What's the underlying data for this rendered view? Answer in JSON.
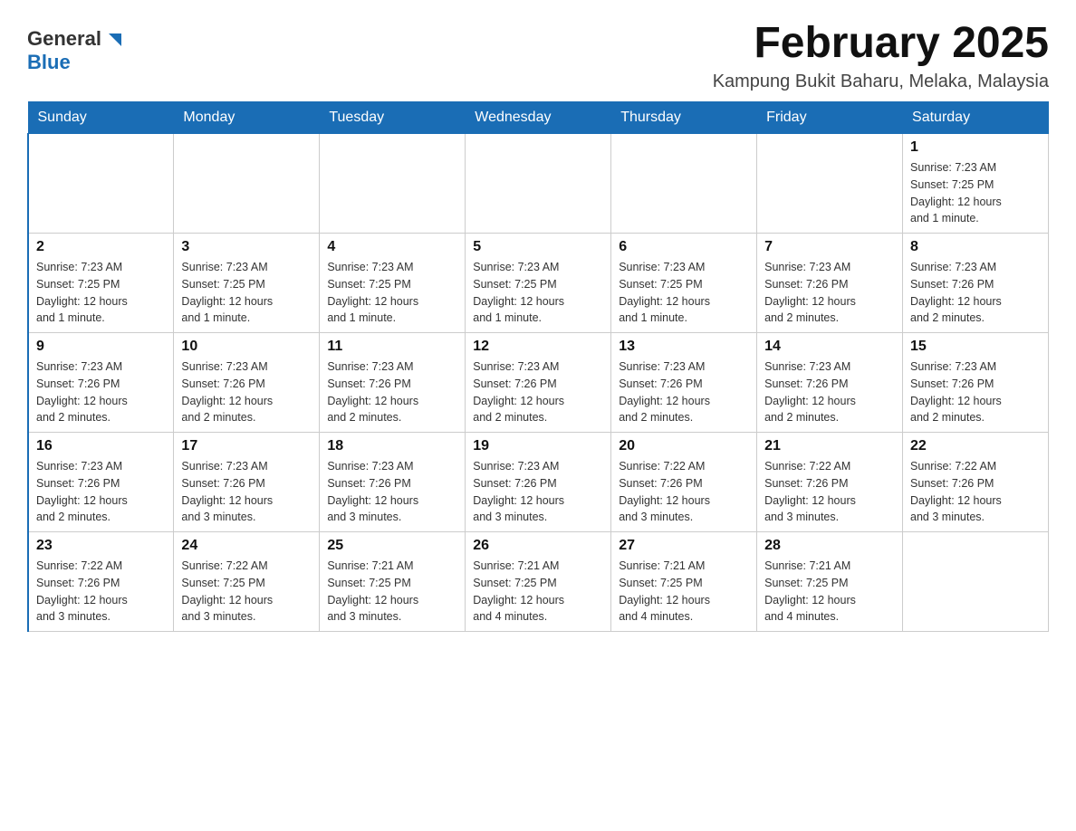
{
  "header": {
    "logo_general": "General",
    "logo_blue": "Blue",
    "month_title": "February 2025",
    "location": "Kampung Bukit Baharu, Melaka, Malaysia"
  },
  "days_of_week": [
    "Sunday",
    "Monday",
    "Tuesday",
    "Wednesday",
    "Thursday",
    "Friday",
    "Saturday"
  ],
  "weeks": [
    [
      {
        "day": "",
        "info": ""
      },
      {
        "day": "",
        "info": ""
      },
      {
        "day": "",
        "info": ""
      },
      {
        "day": "",
        "info": ""
      },
      {
        "day": "",
        "info": ""
      },
      {
        "day": "",
        "info": ""
      },
      {
        "day": "1",
        "info": "Sunrise: 7:23 AM\nSunset: 7:25 PM\nDaylight: 12 hours\nand 1 minute."
      }
    ],
    [
      {
        "day": "2",
        "info": "Sunrise: 7:23 AM\nSunset: 7:25 PM\nDaylight: 12 hours\nand 1 minute."
      },
      {
        "day": "3",
        "info": "Sunrise: 7:23 AM\nSunset: 7:25 PM\nDaylight: 12 hours\nand 1 minute."
      },
      {
        "day": "4",
        "info": "Sunrise: 7:23 AM\nSunset: 7:25 PM\nDaylight: 12 hours\nand 1 minute."
      },
      {
        "day": "5",
        "info": "Sunrise: 7:23 AM\nSunset: 7:25 PM\nDaylight: 12 hours\nand 1 minute."
      },
      {
        "day": "6",
        "info": "Sunrise: 7:23 AM\nSunset: 7:25 PM\nDaylight: 12 hours\nand 1 minute."
      },
      {
        "day": "7",
        "info": "Sunrise: 7:23 AM\nSunset: 7:26 PM\nDaylight: 12 hours\nand 2 minutes."
      },
      {
        "day": "8",
        "info": "Sunrise: 7:23 AM\nSunset: 7:26 PM\nDaylight: 12 hours\nand 2 minutes."
      }
    ],
    [
      {
        "day": "9",
        "info": "Sunrise: 7:23 AM\nSunset: 7:26 PM\nDaylight: 12 hours\nand 2 minutes."
      },
      {
        "day": "10",
        "info": "Sunrise: 7:23 AM\nSunset: 7:26 PM\nDaylight: 12 hours\nand 2 minutes."
      },
      {
        "day": "11",
        "info": "Sunrise: 7:23 AM\nSunset: 7:26 PM\nDaylight: 12 hours\nand 2 minutes."
      },
      {
        "day": "12",
        "info": "Sunrise: 7:23 AM\nSunset: 7:26 PM\nDaylight: 12 hours\nand 2 minutes."
      },
      {
        "day": "13",
        "info": "Sunrise: 7:23 AM\nSunset: 7:26 PM\nDaylight: 12 hours\nand 2 minutes."
      },
      {
        "day": "14",
        "info": "Sunrise: 7:23 AM\nSunset: 7:26 PM\nDaylight: 12 hours\nand 2 minutes."
      },
      {
        "day": "15",
        "info": "Sunrise: 7:23 AM\nSunset: 7:26 PM\nDaylight: 12 hours\nand 2 minutes."
      }
    ],
    [
      {
        "day": "16",
        "info": "Sunrise: 7:23 AM\nSunset: 7:26 PM\nDaylight: 12 hours\nand 2 minutes."
      },
      {
        "day": "17",
        "info": "Sunrise: 7:23 AM\nSunset: 7:26 PM\nDaylight: 12 hours\nand 3 minutes."
      },
      {
        "day": "18",
        "info": "Sunrise: 7:23 AM\nSunset: 7:26 PM\nDaylight: 12 hours\nand 3 minutes."
      },
      {
        "day": "19",
        "info": "Sunrise: 7:23 AM\nSunset: 7:26 PM\nDaylight: 12 hours\nand 3 minutes."
      },
      {
        "day": "20",
        "info": "Sunrise: 7:22 AM\nSunset: 7:26 PM\nDaylight: 12 hours\nand 3 minutes."
      },
      {
        "day": "21",
        "info": "Sunrise: 7:22 AM\nSunset: 7:26 PM\nDaylight: 12 hours\nand 3 minutes."
      },
      {
        "day": "22",
        "info": "Sunrise: 7:22 AM\nSunset: 7:26 PM\nDaylight: 12 hours\nand 3 minutes."
      }
    ],
    [
      {
        "day": "23",
        "info": "Sunrise: 7:22 AM\nSunset: 7:26 PM\nDaylight: 12 hours\nand 3 minutes."
      },
      {
        "day": "24",
        "info": "Sunrise: 7:22 AM\nSunset: 7:25 PM\nDaylight: 12 hours\nand 3 minutes."
      },
      {
        "day": "25",
        "info": "Sunrise: 7:21 AM\nSunset: 7:25 PM\nDaylight: 12 hours\nand 3 minutes."
      },
      {
        "day": "26",
        "info": "Sunrise: 7:21 AM\nSunset: 7:25 PM\nDaylight: 12 hours\nand 4 minutes."
      },
      {
        "day": "27",
        "info": "Sunrise: 7:21 AM\nSunset: 7:25 PM\nDaylight: 12 hours\nand 4 minutes."
      },
      {
        "day": "28",
        "info": "Sunrise: 7:21 AM\nSunset: 7:25 PM\nDaylight: 12 hours\nand 4 minutes."
      },
      {
        "day": "",
        "info": ""
      }
    ]
  ]
}
